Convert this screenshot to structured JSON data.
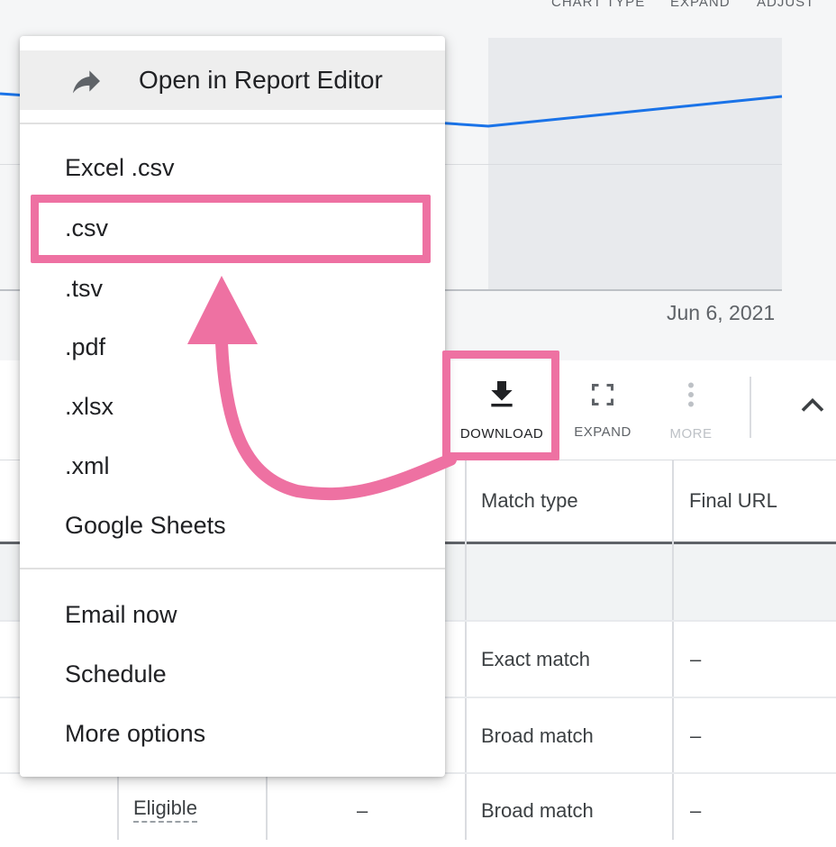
{
  "top_bar": {
    "labels": [
      "CHART TYPE",
      "EXPAND",
      "ADJUST"
    ]
  },
  "chart": {
    "date_label": "Jun 6, 2021",
    "line_color": "#1a73e8"
  },
  "toolbar": {
    "download_label": "DOWNLOAD",
    "expand_label": "EXPAND",
    "more_label": "MORE",
    "download_icon": "download-icon",
    "expand_icon": "fullscreen-icon",
    "more_icon": "more-vert-icon",
    "collapse_icon": "chevron-up-icon"
  },
  "table": {
    "headers": [
      "Match type",
      "Final URL"
    ],
    "rows": [
      {
        "status": "",
        "col3": "",
        "match_type": "Exact match",
        "final_url": "–"
      },
      {
        "status": "",
        "col3": "",
        "match_type": "Broad match",
        "final_url": "–"
      },
      {
        "status": "Eligible",
        "col3": "–",
        "match_type": "Broad match",
        "final_url": "–"
      }
    ]
  },
  "menu": {
    "open_editor": {
      "label": "Open in Report Editor",
      "icon": "forward-arrow-icon"
    },
    "formats": [
      {
        "label": "Excel .csv"
      },
      {
        "label": ".csv"
      },
      {
        "label": ".tsv"
      },
      {
        "label": ".pdf"
      },
      {
        "label": ".xlsx"
      },
      {
        "label": ".xml"
      },
      {
        "label": "Google Sheets"
      }
    ],
    "actions": [
      {
        "label": "Email now"
      },
      {
        "label": "Schedule"
      },
      {
        "label": "More options"
      }
    ]
  },
  "annotation_color": "#ee71a2"
}
